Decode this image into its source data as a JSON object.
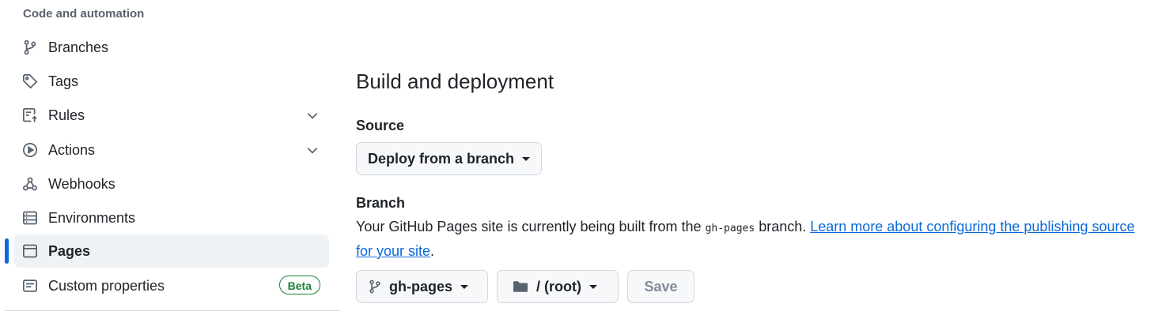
{
  "sidebar": {
    "section_heading": "Code and automation",
    "items": [
      {
        "label": "Branches",
        "icon": "git-branch-icon"
      },
      {
        "label": "Tags",
        "icon": "tag-icon"
      },
      {
        "label": "Rules",
        "icon": "rules-icon",
        "expandable": true
      },
      {
        "label": "Actions",
        "icon": "play-icon",
        "expandable": true
      },
      {
        "label": "Webhooks",
        "icon": "webhook-icon"
      },
      {
        "label": "Environments",
        "icon": "server-icon"
      },
      {
        "label": "Pages",
        "icon": "browser-icon",
        "active": true
      },
      {
        "label": "Custom properties",
        "icon": "note-icon",
        "badge": "Beta"
      }
    ]
  },
  "main": {
    "title": "Build and deployment",
    "source": {
      "label": "Source",
      "selected": "Deploy from a branch"
    },
    "branch": {
      "label": "Branch",
      "description_prefix": "Your GitHub Pages site is currently being built from the ",
      "branch_code": "gh-pages",
      "description_suffix": " branch. ",
      "learn_more_link": "Learn more about configuring the publishing source for your site",
      "period": ".",
      "branch_select": "gh-pages",
      "folder_select": "/ (root)",
      "save_label": "Save"
    }
  },
  "colors": {
    "accent": "#0969da",
    "beta_green": "#1a7f37",
    "active_bg": "#eff2f5"
  }
}
